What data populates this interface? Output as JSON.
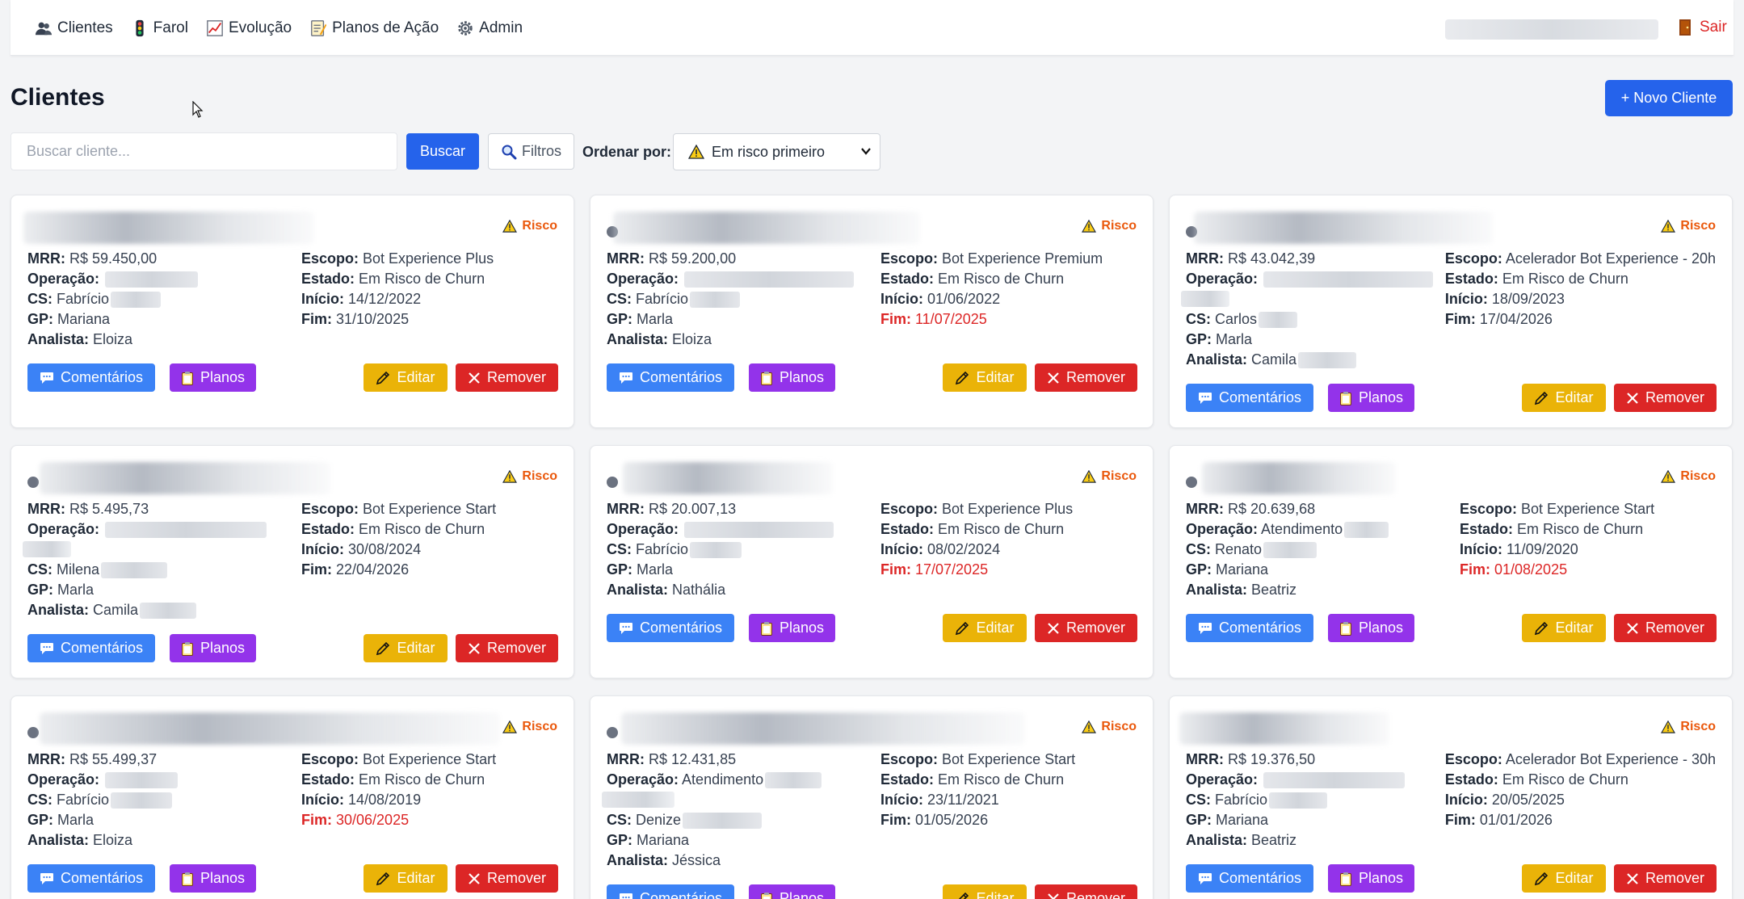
{
  "nav": {
    "items": [
      {
        "label": "Clientes",
        "icon": "users-icon"
      },
      {
        "label": "Farol",
        "icon": "traffic-light-icon"
      },
      {
        "label": "Evolução",
        "icon": "chart-icon"
      },
      {
        "label": "Planos de Ação",
        "icon": "memo-icon"
      },
      {
        "label": "Admin",
        "icon": "gear-icon"
      }
    ],
    "logout": "Sair"
  },
  "page": {
    "title": "Clientes",
    "new_client": "+ Novo Cliente"
  },
  "toolbar": {
    "search_placeholder": "Buscar cliente...",
    "search_button": "Buscar",
    "filter_button": "Filtros",
    "sort_label": "Ordenar por:",
    "sort_value": "Em risco primeiro"
  },
  "card_labels": {
    "mrr": "MRR:",
    "operacao": "Operação:",
    "cs": "CS:",
    "gp": "GP:",
    "analista": "Analista:",
    "escopo": "Escopo:",
    "estado": "Estado:",
    "inicio": "Início:",
    "fim": "Fim:",
    "risk": "Risco",
    "comments": "Comentários",
    "plans": "Planos",
    "edit": "Editar",
    "remove": "Remover"
  },
  "clients": [
    {
      "mrr": "R$ 59.450,00",
      "operacao": "",
      "cs": "Fabrício",
      "gp": "Mariana",
      "analista": "Eloiza",
      "escopo": "Bot Experience Plus",
      "estado": "Em Risco de Churn",
      "inicio": "14/12/2022",
      "fim": "31/10/2025",
      "fim_overdue": false
    },
    {
      "mrr": "R$ 59.200,00",
      "operacao": "",
      "cs": "Fabrício",
      "gp": "Marla",
      "analista": "Eloiza",
      "escopo": "Bot Experience Premium",
      "estado": "Em Risco de Churn",
      "inicio": "01/06/2022",
      "fim": "11/07/2025",
      "fim_overdue": true
    },
    {
      "mrr": "R$ 43.042,39",
      "operacao": "",
      "cs": "Carlos",
      "gp": "Marla",
      "analista": "Camila",
      "escopo": "Acelerador Bot Experience - 20h",
      "estado": "Em Risco de Churn",
      "inicio": "18/09/2023",
      "fim": "17/04/2026",
      "fim_overdue": false
    },
    {
      "mrr": "R$ 5.495,73",
      "operacao": "",
      "cs": "Milena",
      "gp": "Marla",
      "analista": "Camila",
      "escopo": "Bot Experience Start",
      "estado": "Em Risco de Churn",
      "inicio": "30/08/2024",
      "fim": "22/04/2026",
      "fim_overdue": false
    },
    {
      "mrr": "R$ 20.007,13",
      "operacao": "",
      "cs": "Fabrício",
      "gp": "Marla",
      "analista": "Nathália",
      "escopo": "Bot Experience Plus",
      "estado": "Em Risco de Churn",
      "inicio": "08/02/2024",
      "fim": "17/07/2025",
      "fim_overdue": true
    },
    {
      "mrr": "R$ 20.639,68",
      "operacao": "Atendimento",
      "cs": "Renato",
      "gp": "Mariana",
      "analista": "Beatriz",
      "escopo": "Bot Experience Start",
      "estado": "Em Risco de Churn",
      "inicio": "11/09/2020",
      "fim": "01/08/2025",
      "fim_overdue": true
    },
    {
      "mrr": "R$ 55.499,37",
      "operacao": "",
      "cs": "Fabrício",
      "gp": "Marla",
      "analista": "Eloiza",
      "escopo": "Bot Experience Start",
      "estado": "Em Risco de Churn",
      "inicio": "14/08/2019",
      "fim": "30/06/2025",
      "fim_overdue": true
    },
    {
      "mrr": "R$ 12.431,85",
      "operacao": "Atendimento",
      "cs": "Denize",
      "gp": "Mariana",
      "analista": "Jéssica",
      "escopo": "Bot Experience Start",
      "estado": "Em Risco de Churn",
      "inicio": "23/11/2021",
      "fim": "01/05/2026",
      "fim_overdue": false
    },
    {
      "mrr": "R$ 19.376,50",
      "operacao": "",
      "cs": "Fabrício",
      "gp": "Mariana",
      "analista": "Beatriz",
      "escopo": "Acelerador Bot Experience - 30h",
      "estado": "Em Risco de Churn",
      "inicio": "20/05/2025",
      "fim": "01/01/2026",
      "fim_overdue": false
    }
  ],
  "colors": {
    "primary": "#2563eb",
    "comments": "#3b82f6",
    "plans": "#9333ea",
    "edit": "#eab308",
    "remove": "#dc2626",
    "risk": "#ea580c",
    "overdue": "#dc2626"
  }
}
